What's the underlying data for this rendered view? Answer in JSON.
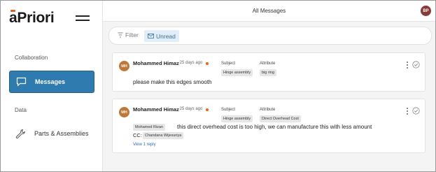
{
  "app": {
    "logo_prefix": "a",
    "logo_rest": "Priori"
  },
  "sidebar": {
    "sections": [
      {
        "label": "Collaboration"
      },
      {
        "label": "Data"
      }
    ],
    "items": [
      {
        "label": "Messages",
        "icon": "message-icon",
        "active": true
      },
      {
        "label": "Parts & Assemblies",
        "icon": "wrench-icon",
        "active": false
      }
    ]
  },
  "header": {
    "title": "All Messages",
    "user_initials": "BP"
  },
  "filters": {
    "filter_label": "Filter",
    "unread_label": "Unread"
  },
  "messages": [
    {
      "avatar": "MH",
      "author": "Mohammed Himaz",
      "time": "- 25 days ago",
      "subject_label": "Subject",
      "subject": "Hinge assembly",
      "attribute_label": "Attribute",
      "attribute": "big ring",
      "text": "please make this edges smooth"
    },
    {
      "avatar": "MH",
      "author": "Mohammed Himaz",
      "time": "- 25 days ago",
      "subject_label": "Subject",
      "subject": "Hinge assembly",
      "attribute_label": "Attribute",
      "attribute": "Direct Overhead Cost",
      "mention": "Mohamed Rizan",
      "text": "this direct overhead cost is too high, we can manufacture this with less amount",
      "cc_label": "CC:",
      "cc": "Chandana Wijesuriya",
      "reply_label": "View 1 reply"
    }
  ],
  "colors": {
    "accent": "#2f7bb0",
    "unread_dot": "#e8650a",
    "avatar_message": "#c0773a",
    "avatar_user": "#8a3b37"
  }
}
